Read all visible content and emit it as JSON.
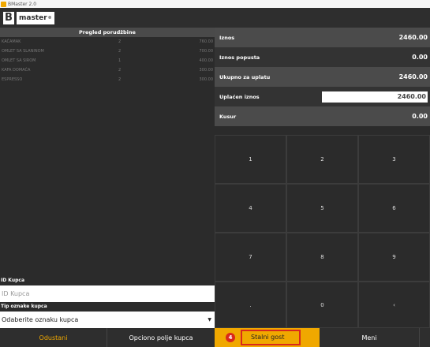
{
  "window": {
    "title": "BMaster 2.0"
  },
  "header": {
    "logo_letter": "B",
    "logo_word": "master",
    "logo_mark": "®"
  },
  "orders": {
    "title": "Pregled porudžbine",
    "rows": [
      {
        "name": "KAČAMAK",
        "qty": "2",
        "price": "760.00"
      },
      {
        "name": "OMLET SA SLANINOM",
        "qty": "2",
        "price": "700.00"
      },
      {
        "name": "OMLET SA SIROM",
        "qty": "1",
        "price": "400.00"
      },
      {
        "name": "KAFA DOMAĆA",
        "qty": "2",
        "price": "300.00"
      },
      {
        "name": "ESPRESSO",
        "qty": "2",
        "price": "300.00"
      }
    ]
  },
  "customer": {
    "id_label": "ID Kupca",
    "id_placeholder": "ID Kupca",
    "type_label": "Tip oznake kupca",
    "type_selected": "Odaberite oznaku kupca"
  },
  "summary": {
    "amount_label": "Iznos",
    "amount_value": "2460.00",
    "discount_label": "Iznos popusta",
    "discount_value": "0.00",
    "total_label": "Ukupno za uplatu",
    "total_value": "2460.00",
    "paid_label": "Uplaćen iznos",
    "paid_value": "2460.00",
    "change_label": "Kusur",
    "change_value": "0.00"
  },
  "keypad": [
    "1",
    "2",
    "3",
    "4",
    "5",
    "6",
    "7",
    "8",
    "9",
    ".",
    "0",
    "‹"
  ],
  "buttons": {
    "cancel": "Odustani",
    "optional": "Opciono polje kupca",
    "regular_guest": "Stalni gost",
    "regular_badge": "4",
    "menu": "Meni"
  },
  "colors": {
    "accent": "#f0a800",
    "highlight": "#d9281c"
  }
}
